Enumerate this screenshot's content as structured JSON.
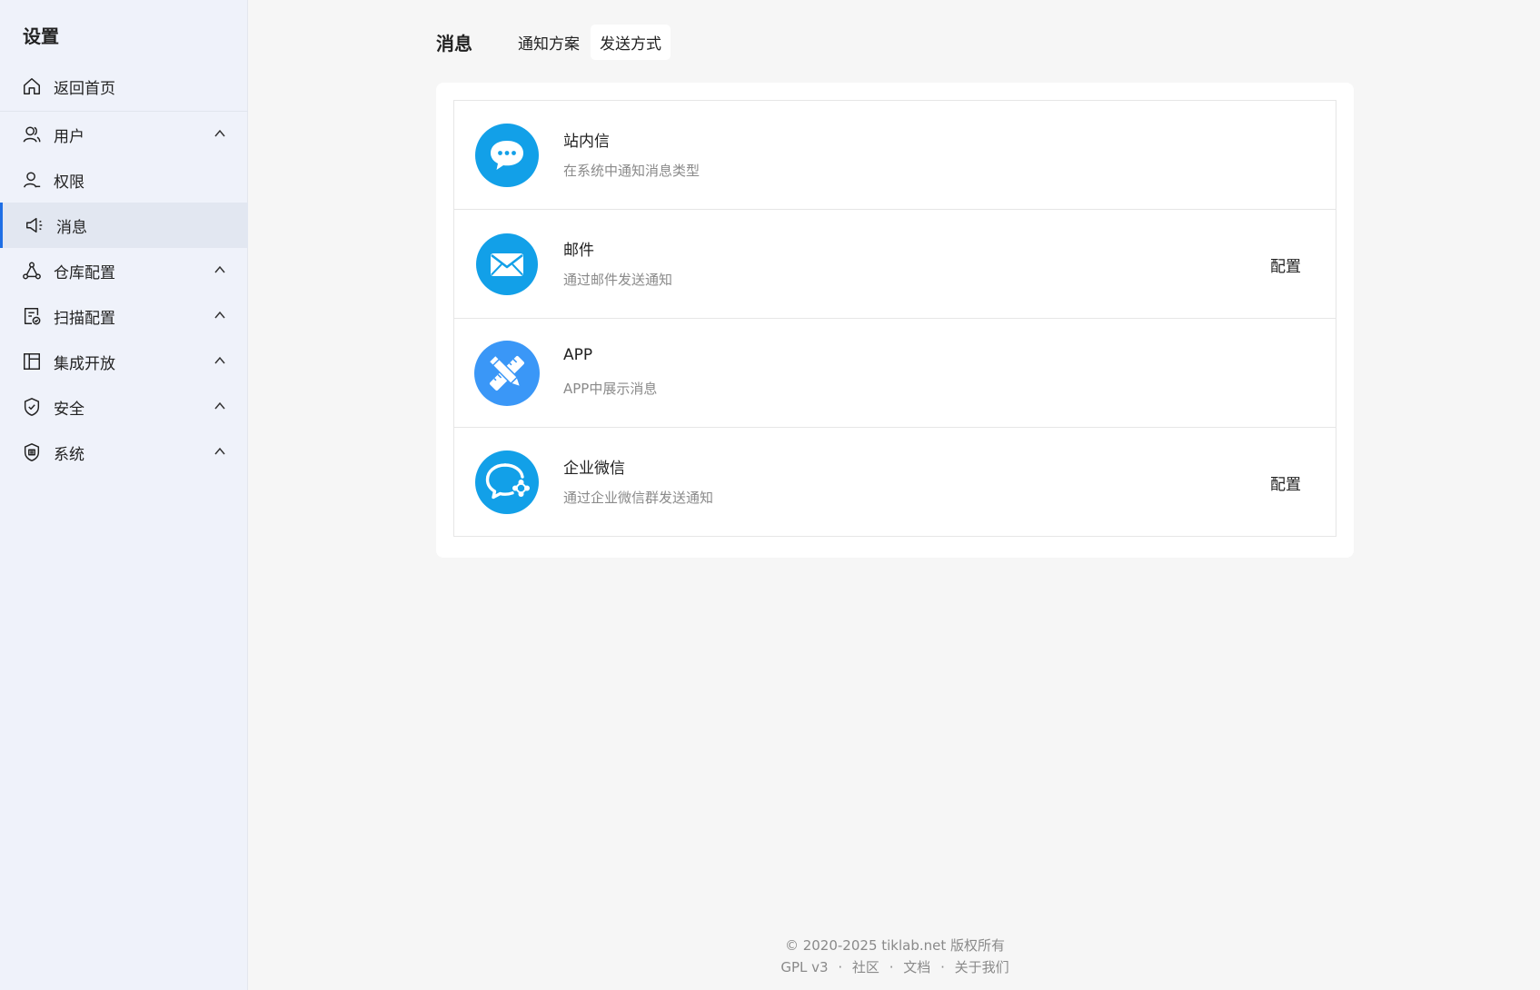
{
  "sidebar": {
    "title": "设置",
    "items": [
      {
        "label": "返回首页",
        "icon": "home-icon"
      },
      {
        "label": "用户",
        "icon": "users-icon",
        "expandable": true
      },
      {
        "label": "权限",
        "icon": "user-icon"
      },
      {
        "label": "消息",
        "icon": "megaphone-icon",
        "active": true
      },
      {
        "label": "仓库配置",
        "icon": "repo-icon",
        "expandable": true
      },
      {
        "label": "扫描配置",
        "icon": "scan-icon",
        "expandable": true
      },
      {
        "label": "集成开放",
        "icon": "layout-icon",
        "expandable": true
      },
      {
        "label": "安全",
        "icon": "shield-icon",
        "expandable": true
      },
      {
        "label": "系统",
        "icon": "cert-icon",
        "expandable": true
      }
    ]
  },
  "header": {
    "title": "消息",
    "tabs": [
      {
        "label": "通知方案",
        "active": false
      },
      {
        "label": "发送方式",
        "active": true
      }
    ]
  },
  "methods": [
    {
      "title": "站内信",
      "desc": "在系统中通知消息类型",
      "icon": "chat-dots-icon",
      "config": ""
    },
    {
      "title": "邮件",
      "desc": "通过邮件发送通知",
      "icon": "mail-icon",
      "config": "配置"
    },
    {
      "title": "APP",
      "desc": "APP中展示消息",
      "icon": "pencil-ruler-icon",
      "config": ""
    },
    {
      "title": "企业微信",
      "desc": "通过企业微信群发送通知",
      "icon": "wecom-icon",
      "config": "配置"
    }
  ],
  "footer": {
    "copyright": "© 2020-2025 tiklab.net 版权所有",
    "links": [
      "GPL v3",
      "社区",
      "文档",
      "关于我们"
    ],
    "separator": "·"
  },
  "colors": {
    "accent": "#1f6fe5",
    "icon_blue": "#12a0e8",
    "icon_blue_app": "#3a97f7"
  }
}
